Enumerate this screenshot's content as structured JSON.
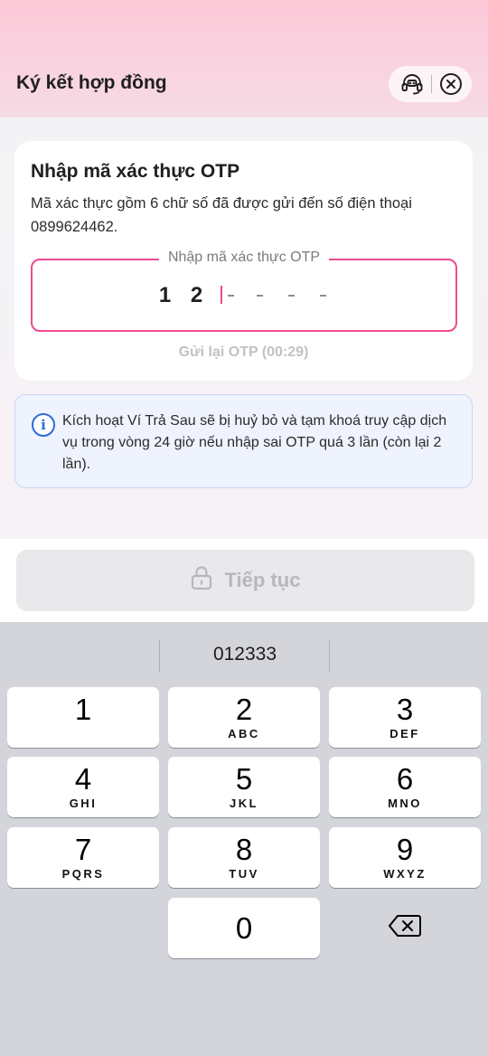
{
  "header": {
    "title": "Ký kết hợp đồng",
    "support_icon": "headset-icon",
    "close_icon": "close-icon"
  },
  "otp_card": {
    "title": "Nhập mã xác thực OTP",
    "description": "Mã xác thực gồm 6 chữ số đã được gửi đến số điện thoại 0899624462.",
    "input_label": "Nhập mã xác thực OTP",
    "digits": [
      "1",
      "2",
      "",
      "",
      "",
      ""
    ],
    "resend_label": "Gửi lại OTP (00:29)"
  },
  "warning": {
    "icon": "info-icon",
    "text": "Kích hoạt Ví Trả Sau sẽ bị huỷ bỏ và tạm khoá truy cập dịch vụ trong vòng 24 giờ nếu nhập sai OTP quá 3 lần (còn lại 2 lần)."
  },
  "continue_button": {
    "label": "Tiếp tục",
    "icon": "lock-icon"
  },
  "keyboard": {
    "suggestion": "012333",
    "keys": [
      {
        "num": "1",
        "letters": ""
      },
      {
        "num": "2",
        "letters": "ABC"
      },
      {
        "num": "3",
        "letters": "DEF"
      },
      {
        "num": "4",
        "letters": "GHI"
      },
      {
        "num": "5",
        "letters": "JKL"
      },
      {
        "num": "6",
        "letters": "MNO"
      },
      {
        "num": "7",
        "letters": "PQRS"
      },
      {
        "num": "8",
        "letters": "TUV"
      },
      {
        "num": "9",
        "letters": "WXYZ"
      },
      {
        "num": "0",
        "letters": ""
      }
    ],
    "backspace_icon": "backspace-icon"
  },
  "colors": {
    "accent": "#ee4b92",
    "info": "#2d6ad8",
    "header_gradient_top": "#fcc8d8"
  }
}
